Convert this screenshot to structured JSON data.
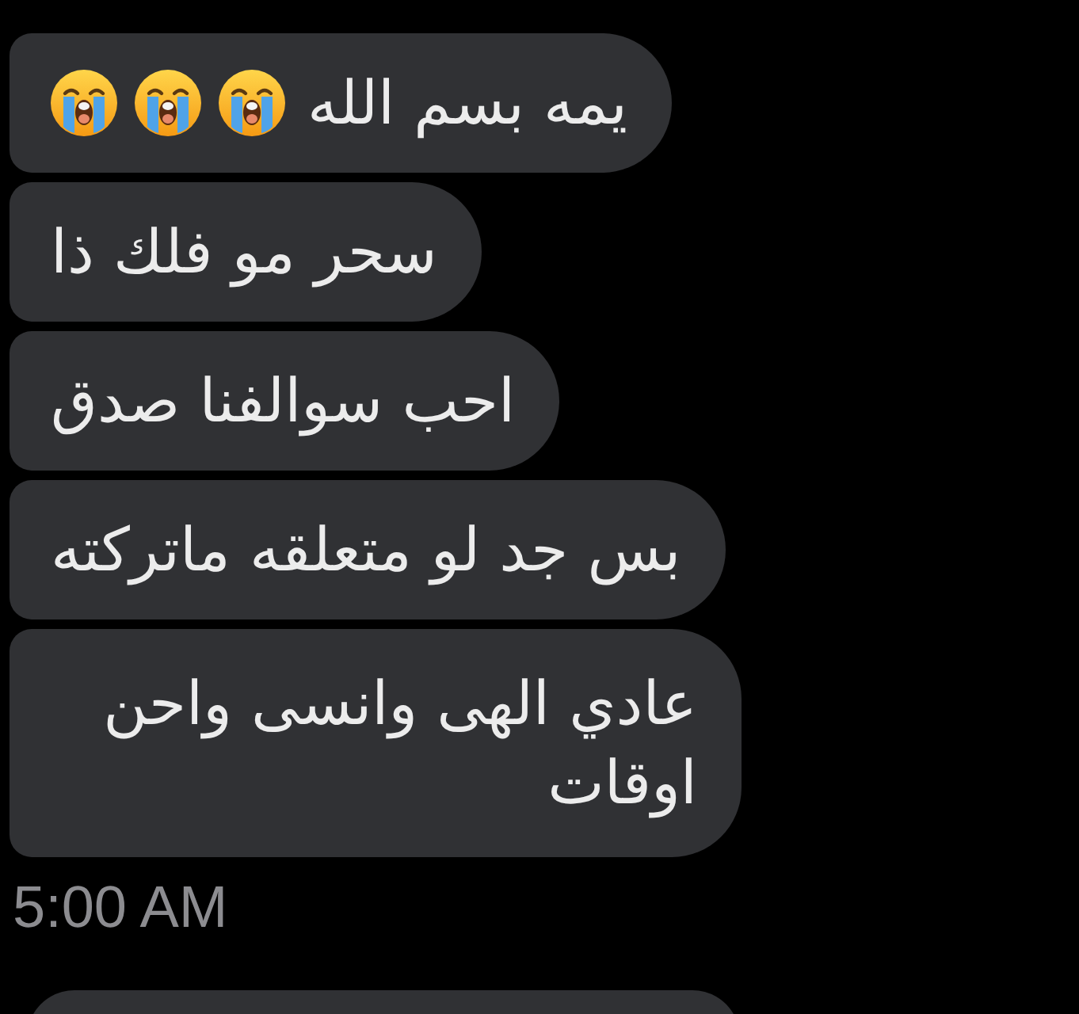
{
  "messages": [
    {
      "text": "يمه بسم الله",
      "emojis": [
        {
          "kind": "loudly-crying"
        },
        {
          "kind": "loudly-crying"
        },
        {
          "kind": "loudly-crying"
        }
      ]
    },
    {
      "text": "سحر مو فلك ذا"
    },
    {
      "text": "احب سوالفنا صدق"
    },
    {
      "text": "بس جد لو متعلقه ماتركته"
    },
    {
      "text": "عادي الهى وانسى واحن اوقات"
    }
  ],
  "timestamp": "5:00 AM",
  "next_message": {
    "kind": "cut-off"
  }
}
